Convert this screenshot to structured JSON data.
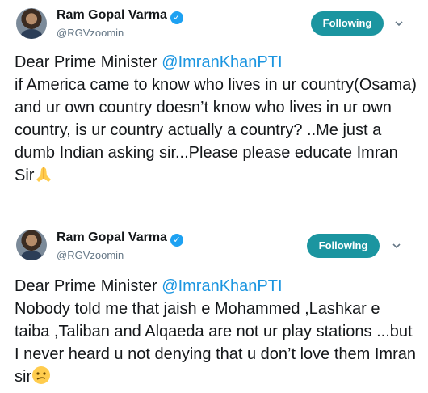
{
  "tweets": [
    {
      "author": {
        "name": "Ram Gopal Varma",
        "handle": "@RGVzoomin",
        "verified_icon": "verified-badge-icon"
      },
      "follow_button_label": "Following",
      "text_before_mention": "Dear Prime Minister ",
      "mention": "@ImranKhanPTI",
      "text_after_mention": "\n if America came to know who lives in ur country(Osama) and ur own country doesn’t know who lives in ur own country, is ur country actually a country?  ..Me just a dumb Indian asking sir...Please please educate Imran Sir",
      "emoji": "folded-hands-icon"
    },
    {
      "author": {
        "name": "Ram Gopal Varma",
        "handle": "@RGVzoomin",
        "verified_icon": "verified-badge-icon"
      },
      "follow_button_label": "Following",
      "text_before_mention": "Dear Prime Minister ",
      "mention": "@ImranKhanPTI",
      "text_after_mention": "\n Nobody told me that jaish e Mohammed ,Lashkar e taiba ,Taliban and Alqaeda are not ur play stations ...but I never heard u not denying that u don’t love them Imran  sir",
      "emoji": "confused-face-icon"
    }
  ],
  "colors": {
    "accent": "#1b95a0",
    "link": "#1b95e0",
    "verified": "#1da1f2",
    "secondary_text": "#657786"
  }
}
